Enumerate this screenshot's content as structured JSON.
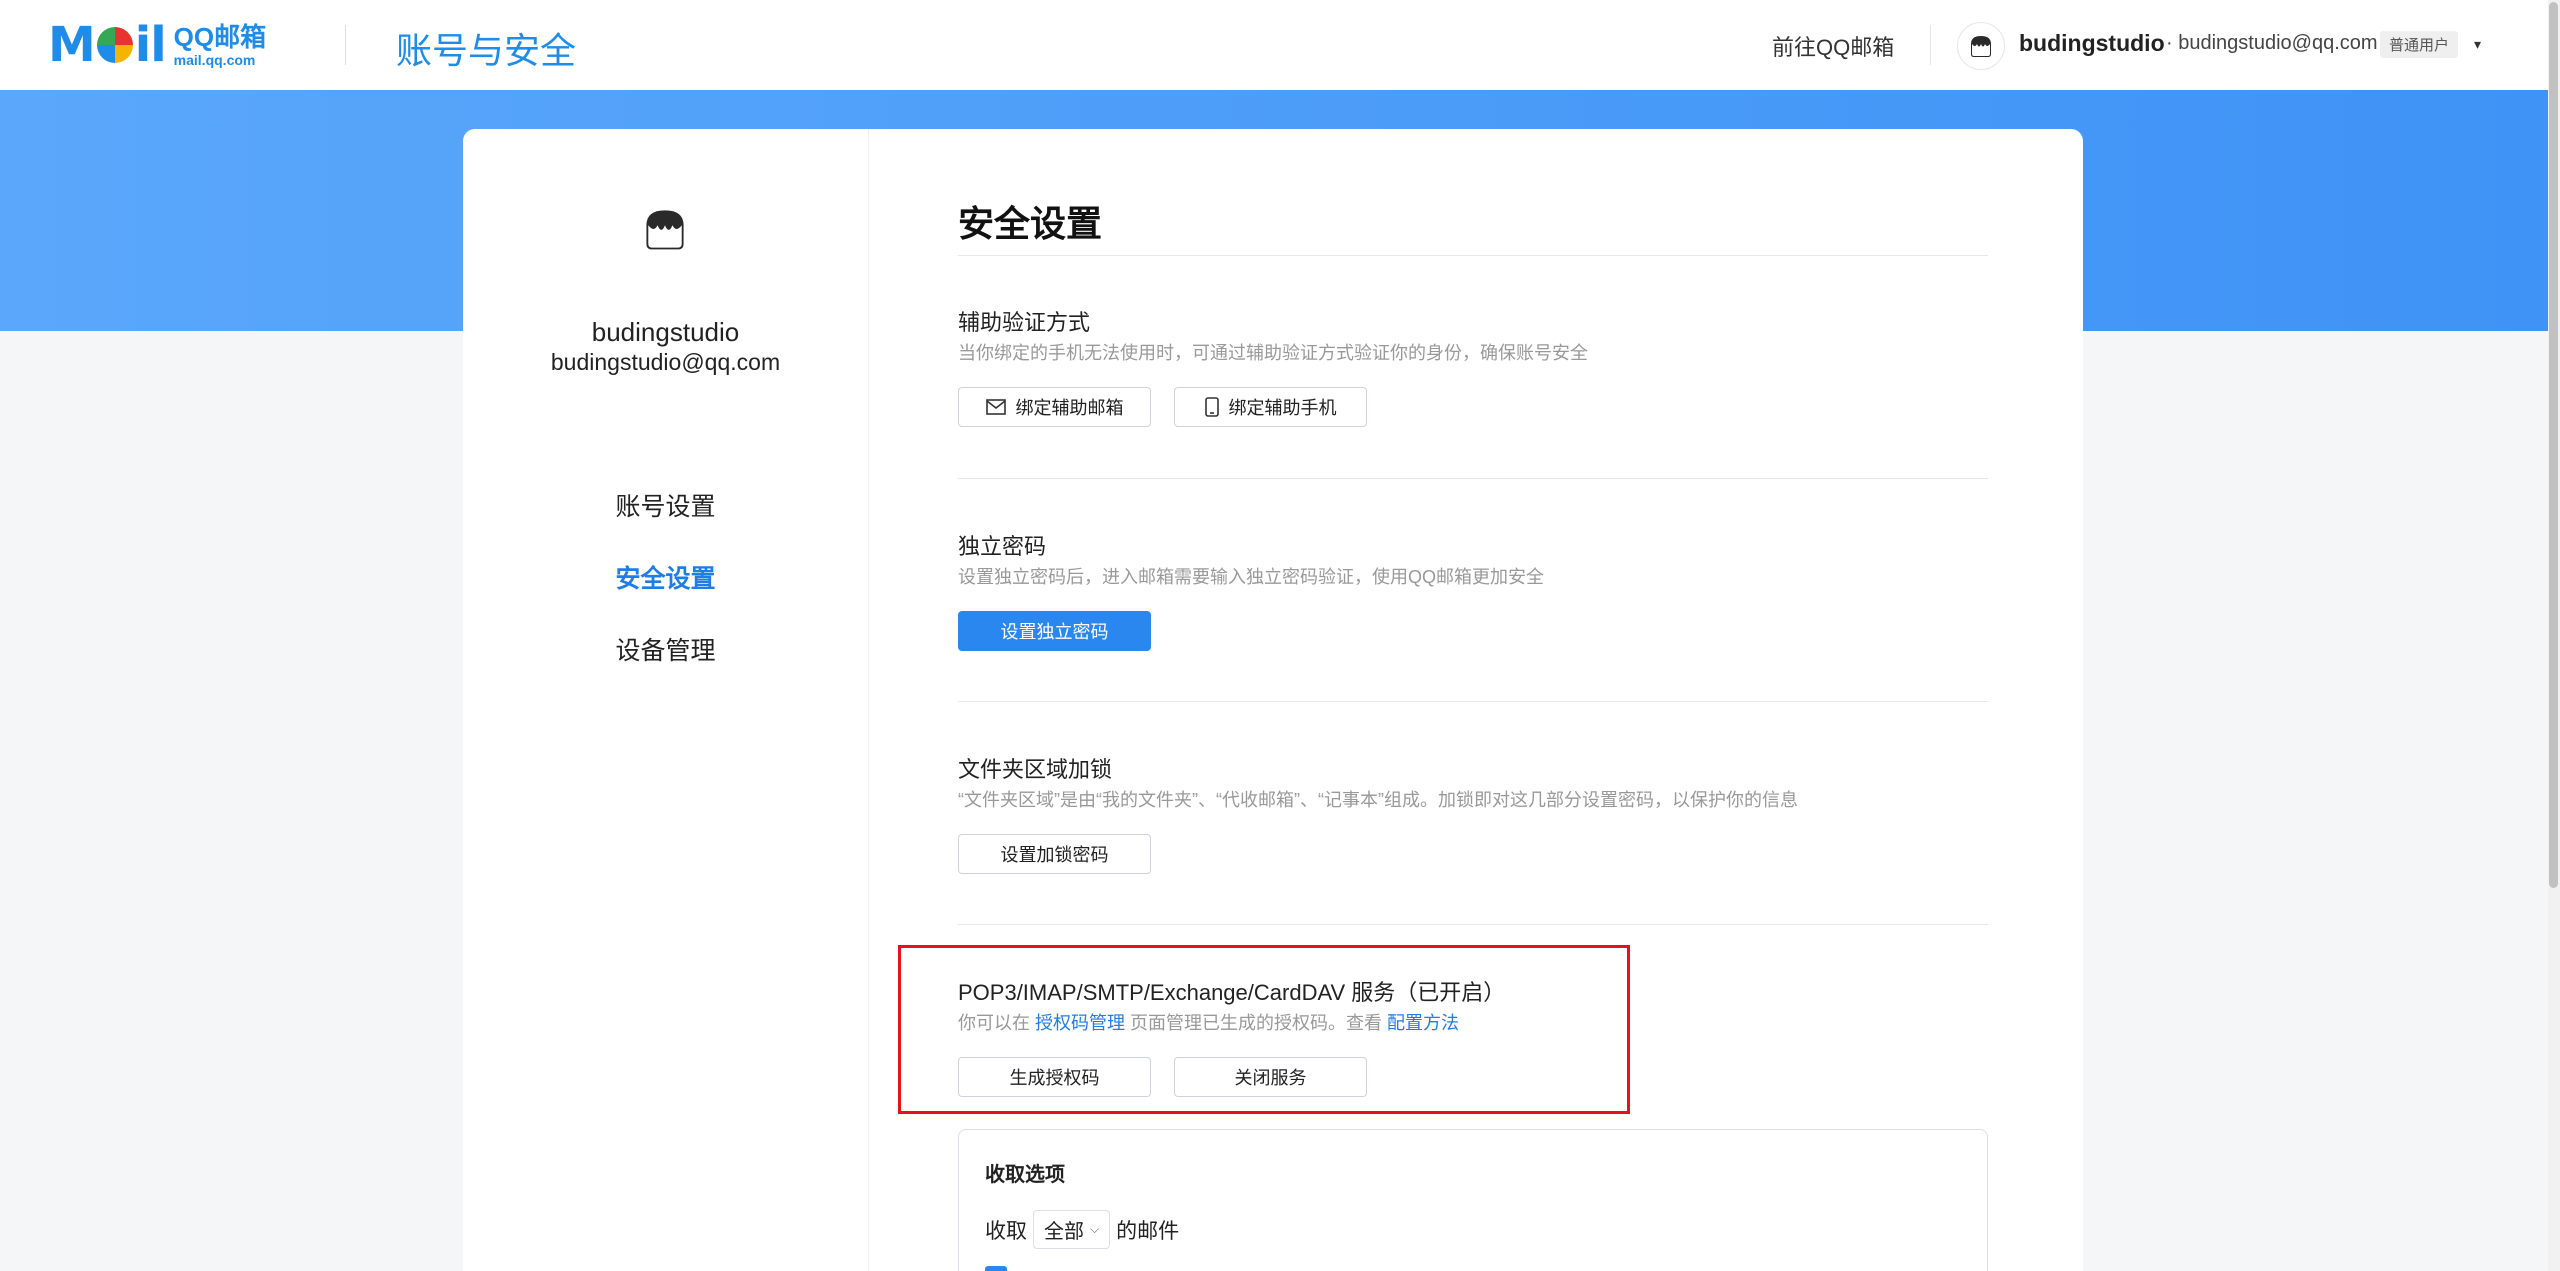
{
  "header": {
    "logo_mark": "M",
    "logo_mark_tail": "il",
    "logo_brand": "QQ邮箱",
    "logo_domain": "mail.qq.com",
    "page_title": "账号与安全",
    "goto_link": "前往QQ邮箱",
    "user_name": "budingstudio",
    "user_email": "· budingstudio@qq.com",
    "user_badge": "普通用户",
    "caret": "▾"
  },
  "sidebar": {
    "username": "budingstudio",
    "email": "budingstudio@qq.com",
    "items": [
      {
        "label": "账号设置",
        "active": false
      },
      {
        "label": "安全设置",
        "active": true
      },
      {
        "label": "设备管理",
        "active": false
      }
    ]
  },
  "main": {
    "title": "安全设置",
    "sections": {
      "aux_verify": {
        "title": "辅助验证方式",
        "desc": "当你绑定的手机无法使用时，可通过辅助验证方式验证你的身份，确保账号安全",
        "btn_email": "绑定辅助邮箱",
        "btn_phone": "绑定辅助手机"
      },
      "independent_password": {
        "title": "独立密码",
        "desc": "设置独立密码后，进入邮箱需要输入独立密码验证，使用QQ邮箱更加安全",
        "btn": "设置独立密码"
      },
      "folder_lock": {
        "title": "文件夹区域加锁",
        "desc": "“文件夹区域”是由“我的文件夹”、“代收邮箱”、“记事本”组成。加锁即对这几部分设置密码，以保护你的信息",
        "btn": "设置加锁密码"
      },
      "pop3": {
        "title": "POP3/IMAP/SMTP/Exchange/CardDAV 服务（已开启）",
        "desc_prefix": "你可以在 ",
        "desc_link1": "授权码管理",
        "desc_middle": " 页面管理已生成的授权码。查看 ",
        "desc_link2": "配置方法",
        "btn_generate": "生成授权码",
        "btn_close": "关闭服务"
      },
      "receive": {
        "title": "收取选项",
        "prefix": "收取",
        "select_value": "全部",
        "suffix": "的邮件"
      }
    }
  },
  "colors": {
    "accent": "#1e7ee8",
    "banner": "#4a9cf8",
    "highlight": "#e3121d"
  }
}
